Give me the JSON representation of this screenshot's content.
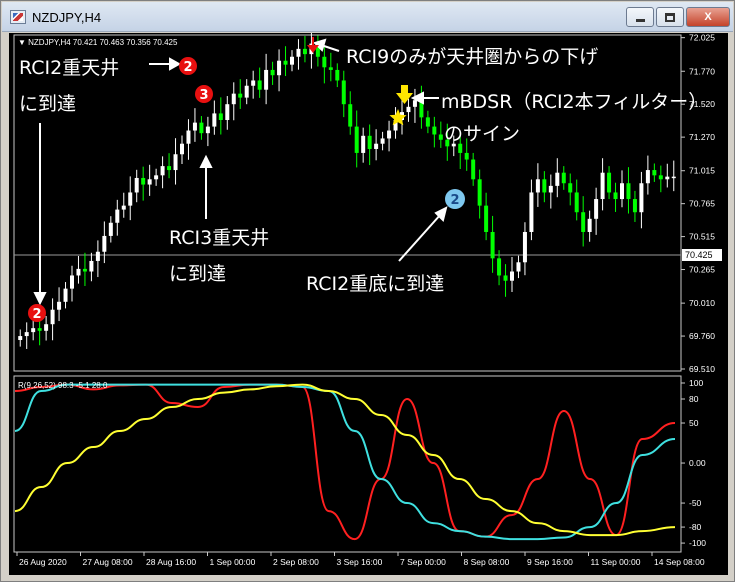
{
  "window": {
    "title": "NZDJPY,H4",
    "buttons": {
      "minimize": "minimize",
      "maximize": "maximize",
      "close": "X"
    }
  },
  "header": {
    "symbol_line": "▼ NZDJPY,H4  70.421 70.463 70.356 70.425"
  },
  "indicator": {
    "label": "R(9,26,52) 98.3 -5.1 28.0"
  },
  "price_axis": {
    "ticks": [
      "72.025",
      "71.770",
      "71.520",
      "71.270",
      "71.015",
      "70.765",
      "70.515",
      "70.265",
      "70.010",
      "69.760",
      "69.510"
    ],
    "current_price": "70.425"
  },
  "rci_axis": {
    "ticks": [
      "100",
      "80",
      "50",
      "0.00",
      "-50",
      "-80",
      "-100"
    ]
  },
  "time_axis": {
    "ticks": [
      "26 Aug 2020",
      "27 Aug 08:00",
      "28 Aug 16:00",
      "1 Sep 00:00",
      "2 Sep 08:00",
      "3 Sep 16:00",
      "7 Sep 00:00",
      "8 Sep 08:00",
      "9 Sep 16:00",
      "11 Sep 00:00",
      "14 Sep 08:00"
    ]
  },
  "annotations": {
    "rci9_top": "RCI9のみが天井圏からの下げ",
    "rci2_top_line1": "RCI2重天井",
    "rci2_top_line2": "に到達",
    "rci3_top_line1": "RCI3重天井",
    "rci3_top_line2": "に到達",
    "mbdsr_line1": "mBDSR（RCI2本フィルター）",
    "mbdsr_line2": "のサイン",
    "rci2_bottom": "RCI2重底に到達",
    "marker_2": "2",
    "marker_3": "3"
  },
  "colors": {
    "bull": "#ffffff",
    "bear": "#00ff00",
    "rci_short": "#ff2020",
    "rci_mid": "#3fe0e0",
    "rci_long": "#ffff33",
    "marker_red": "#e81010",
    "marker_blue": "#7ec8ef",
    "mbdsr_arrow": "#ffe600"
  },
  "chart_data": [
    {
      "type": "candlestick",
      "title": "NZDJPY,H4",
      "ylim": [
        69.51,
        72.1
      ],
      "y_ticks": [
        72.025,
        71.77,
        71.52,
        71.27,
        71.015,
        70.765,
        70.515,
        70.265,
        70.01,
        69.76,
        69.51
      ],
      "current_price": 70.425,
      "close": [
        69.76,
        69.79,
        69.82,
        69.8,
        69.85,
        69.96,
        70.02,
        70.12,
        70.22,
        70.27,
        70.25,
        70.33,
        70.4,
        70.52,
        70.62,
        70.72,
        70.75,
        70.85,
        70.96,
        70.91,
        70.95,
        70.98,
        71.05,
        71.02,
        71.14,
        71.22,
        71.32,
        71.38,
        71.3,
        71.35,
        71.45,
        71.4,
        71.52,
        71.6,
        71.57,
        71.66,
        71.7,
        71.63,
        71.78,
        71.74,
        71.85,
        71.82,
        71.88,
        71.94,
        71.9,
        71.98,
        71.88,
        71.8,
        71.78,
        71.7,
        71.52,
        71.35,
        71.15,
        71.28,
        71.18,
        71.22,
        71.26,
        71.32,
        71.4,
        71.46,
        71.5,
        71.55,
        71.42,
        71.35,
        71.29,
        71.25,
        71.2,
        71.22,
        71.15,
        71.1,
        70.95,
        70.75,
        70.55,
        70.35,
        70.22,
        70.18,
        70.25,
        70.32,
        70.55,
        70.85,
        70.95,
        70.85,
        70.9,
        71.0,
        70.92,
        70.85,
        70.7,
        70.55,
        70.65,
        70.8,
        71.0,
        70.85,
        70.8,
        70.92,
        70.8,
        70.7,
        70.92,
        71.02,
        70.98,
        70.95,
        70.97,
        70.97
      ],
      "x_tick_labels": [
        "26 Aug 2020",
        "27 Aug 08:00",
        "28 Aug 16:00",
        "1 Sep 00:00",
        "2 Sep 08:00",
        "3 Sep 16:00",
        "7 Sep 00:00",
        "8 Sep 08:00",
        "9 Sep 16:00",
        "11 Sep 00:00",
        "14 Sep 08:00"
      ]
    },
    {
      "type": "line",
      "title": "R(9,26,52) 98.3 -5.1 28.0",
      "ylim": [
        -100,
        100
      ],
      "y_ticks": [
        100,
        80,
        50,
        0,
        -50,
        -80,
        -100
      ],
      "x": [
        0,
        4,
        8,
        12,
        16,
        20,
        24,
        28,
        32,
        36,
        40,
        44,
        48,
        52,
        56,
        60,
        64,
        68,
        72,
        76,
        80,
        84,
        88,
        92,
        96,
        101
      ],
      "series": [
        {
          "name": "RCI(9)",
          "color": "red",
          "values": [
            90,
            95,
            98,
            92,
            97,
            98,
            75,
            70,
            95,
            98,
            98,
            95,
            -60,
            -95,
            -20,
            80,
            0,
            -85,
            -92,
            -65,
            -20,
            65,
            -20,
            -90,
            30,
            50
          ]
        },
        {
          "name": "RCI(26)",
          "color": "cyan",
          "values": [
            40,
            90,
            98,
            98,
            98,
            98,
            98,
            98,
            98,
            98,
            98,
            95,
            90,
            40,
            -20,
            -50,
            -75,
            -85,
            -92,
            -95,
            -95,
            -93,
            -80,
            -50,
            10,
            30
          ]
        },
        {
          "name": "RCI(52)",
          "color": "yellow",
          "values": [
            -60,
            -30,
            0,
            20,
            40,
            55,
            70,
            80,
            88,
            92,
            96,
            98,
            90,
            80,
            60,
            35,
            10,
            -20,
            -45,
            -60,
            -75,
            -85,
            -90,
            -90,
            -85,
            -80
          ]
        }
      ]
    }
  ]
}
